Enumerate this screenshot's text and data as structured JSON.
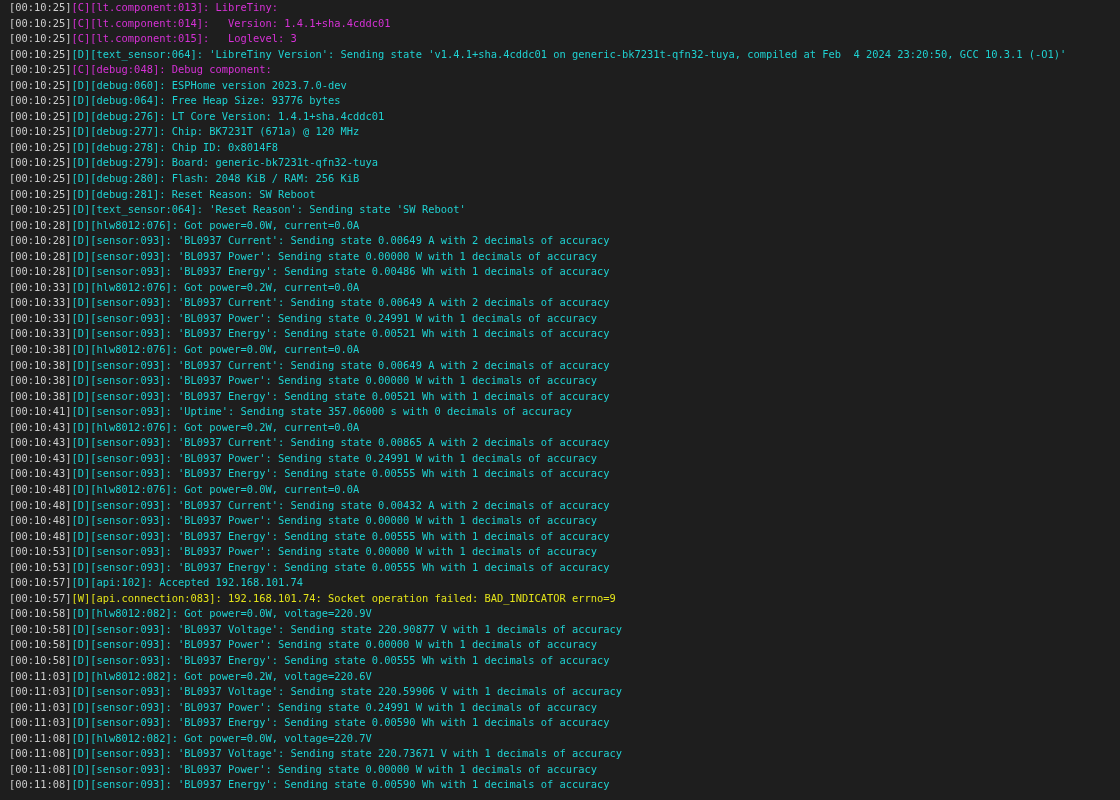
{
  "log_lines": [
    {
      "kind": "config",
      "time": "[00:10:25]",
      "text": "[C][lt.component:013]: LibreTiny:"
    },
    {
      "kind": "config",
      "time": "[00:10:25]",
      "text": "[C][lt.component:014]:   Version: 1.4.1+sha.4cddc01"
    },
    {
      "kind": "config",
      "time": "[00:10:25]",
      "text": "[C][lt.component:015]:   Loglevel: 3"
    },
    {
      "kind": "debug",
      "time": "[00:10:25]",
      "text": "[D][text_sensor:064]: 'LibreTiny Version': Sending state 'v1.4.1+sha.4cddc01 on generic-bk7231t-qfn32-tuya, compiled at Feb  4 2024 23:20:50, GCC 10.3.1 (-O1)'"
    },
    {
      "kind": "config",
      "time": "[00:10:25]",
      "text": "[C][debug:048]: Debug component:"
    },
    {
      "kind": "debug",
      "time": "[00:10:25]",
      "text": "[D][debug:060]: ESPHome version 2023.7.0-dev"
    },
    {
      "kind": "debug",
      "time": "[00:10:25]",
      "text": "[D][debug:064]: Free Heap Size: 93776 bytes"
    },
    {
      "kind": "debug",
      "time": "[00:10:25]",
      "text": "[D][debug:276]: LT Core Version: 1.4.1+sha.4cddc01"
    },
    {
      "kind": "debug",
      "time": "[00:10:25]",
      "text": "[D][debug:277]: Chip: BK7231T (671a) @ 120 MHz"
    },
    {
      "kind": "debug",
      "time": "[00:10:25]",
      "text": "[D][debug:278]: Chip ID: 0x8014F8"
    },
    {
      "kind": "debug",
      "time": "[00:10:25]",
      "text": "[D][debug:279]: Board: generic-bk7231t-qfn32-tuya"
    },
    {
      "kind": "debug",
      "time": "[00:10:25]",
      "text": "[D][debug:280]: Flash: 2048 KiB / RAM: 256 KiB"
    },
    {
      "kind": "debug",
      "time": "[00:10:25]",
      "text": "[D][debug:281]: Reset Reason: SW Reboot"
    },
    {
      "kind": "debug",
      "time": "[00:10:25]",
      "text": "[D][text_sensor:064]: 'Reset Reason': Sending state 'SW Reboot'"
    },
    {
      "kind": "debug",
      "time": "[00:10:28]",
      "text": "[D][hlw8012:076]: Got power=0.0W, current=0.0A"
    },
    {
      "kind": "debug",
      "time": "[00:10:28]",
      "text": "[D][sensor:093]: 'BL0937 Current': Sending state 0.00649 A with 2 decimals of accuracy"
    },
    {
      "kind": "debug",
      "time": "[00:10:28]",
      "text": "[D][sensor:093]: 'BL0937 Power': Sending state 0.00000 W with 1 decimals of accuracy"
    },
    {
      "kind": "debug",
      "time": "[00:10:28]",
      "text": "[D][sensor:093]: 'BL0937 Energy': Sending state 0.00486 Wh with 1 decimals of accuracy"
    },
    {
      "kind": "debug",
      "time": "[00:10:33]",
      "text": "[D][hlw8012:076]: Got power=0.2W, current=0.0A"
    },
    {
      "kind": "debug",
      "time": "[00:10:33]",
      "text": "[D][sensor:093]: 'BL0937 Current': Sending state 0.00649 A with 2 decimals of accuracy"
    },
    {
      "kind": "debug",
      "time": "[00:10:33]",
      "text": "[D][sensor:093]: 'BL0937 Power': Sending state 0.24991 W with 1 decimals of accuracy"
    },
    {
      "kind": "debug",
      "time": "[00:10:33]",
      "text": "[D][sensor:093]: 'BL0937 Energy': Sending state 0.00521 Wh with 1 decimals of accuracy"
    },
    {
      "kind": "debug",
      "time": "[00:10:38]",
      "text": "[D][hlw8012:076]: Got power=0.0W, current=0.0A"
    },
    {
      "kind": "debug",
      "time": "[00:10:38]",
      "text": "[D][sensor:093]: 'BL0937 Current': Sending state 0.00649 A with 2 decimals of accuracy"
    },
    {
      "kind": "debug",
      "time": "[00:10:38]",
      "text": "[D][sensor:093]: 'BL0937 Power': Sending state 0.00000 W with 1 decimals of accuracy"
    },
    {
      "kind": "debug",
      "time": "[00:10:38]",
      "text": "[D][sensor:093]: 'BL0937 Energy': Sending state 0.00521 Wh with 1 decimals of accuracy"
    },
    {
      "kind": "debug",
      "time": "[00:10:41]",
      "text": "[D][sensor:093]: 'Uptime': Sending state 357.06000 s with 0 decimals of accuracy"
    },
    {
      "kind": "debug",
      "time": "[00:10:43]",
      "text": "[D][hlw8012:076]: Got power=0.2W, current=0.0A"
    },
    {
      "kind": "debug",
      "time": "[00:10:43]",
      "text": "[D][sensor:093]: 'BL0937 Current': Sending state 0.00865 A with 2 decimals of accuracy"
    },
    {
      "kind": "debug",
      "time": "[00:10:43]",
      "text": "[D][sensor:093]: 'BL0937 Power': Sending state 0.24991 W with 1 decimals of accuracy"
    },
    {
      "kind": "debug",
      "time": "[00:10:43]",
      "text": "[D][sensor:093]: 'BL0937 Energy': Sending state 0.00555 Wh with 1 decimals of accuracy"
    },
    {
      "kind": "debug",
      "time": "[00:10:48]",
      "text": "[D][hlw8012:076]: Got power=0.0W, current=0.0A"
    },
    {
      "kind": "debug",
      "time": "[00:10:48]",
      "text": "[D][sensor:093]: 'BL0937 Current': Sending state 0.00432 A with 2 decimals of accuracy"
    },
    {
      "kind": "debug",
      "time": "[00:10:48]",
      "text": "[D][sensor:093]: 'BL0937 Power': Sending state 0.00000 W with 1 decimals of accuracy"
    },
    {
      "kind": "debug",
      "time": "[00:10:48]",
      "text": "[D][sensor:093]: 'BL0937 Energy': Sending state 0.00555 Wh with 1 decimals of accuracy"
    },
    {
      "kind": "debug",
      "time": "[00:10:53]",
      "text": "[D][sensor:093]: 'BL0937 Power': Sending state 0.00000 W with 1 decimals of accuracy"
    },
    {
      "kind": "debug",
      "time": "[00:10:53]",
      "text": "[D][sensor:093]: 'BL0937 Energy': Sending state 0.00555 Wh with 1 decimals of accuracy"
    },
    {
      "kind": "debug",
      "time": "[00:10:57]",
      "text": "[D][api:102]: Accepted 192.168.101.74"
    },
    {
      "kind": "warning",
      "time": "[00:10:57]",
      "text": "[W][api.connection:083]: 192.168.101.74: Socket operation failed: BAD_INDICATOR errno=9"
    },
    {
      "kind": "debug",
      "time": "[00:10:58]",
      "text": "[D][hlw8012:082]: Got power=0.0W, voltage=220.9V"
    },
    {
      "kind": "debug",
      "time": "[00:10:58]",
      "text": "[D][sensor:093]: 'BL0937 Voltage': Sending state 220.90877 V with 1 decimals of accuracy"
    },
    {
      "kind": "debug",
      "time": "[00:10:58]",
      "text": "[D][sensor:093]: 'BL0937 Power': Sending state 0.00000 W with 1 decimals of accuracy"
    },
    {
      "kind": "debug",
      "time": "[00:10:58]",
      "text": "[D][sensor:093]: 'BL0937 Energy': Sending state 0.00555 Wh with 1 decimals of accuracy"
    },
    {
      "kind": "debug",
      "time": "[00:11:03]",
      "text": "[D][hlw8012:082]: Got power=0.2W, voltage=220.6V"
    },
    {
      "kind": "debug",
      "time": "[00:11:03]",
      "text": "[D][sensor:093]: 'BL0937 Voltage': Sending state 220.59906 V with 1 decimals of accuracy"
    },
    {
      "kind": "debug",
      "time": "[00:11:03]",
      "text": "[D][sensor:093]: 'BL0937 Power': Sending state 0.24991 W with 1 decimals of accuracy"
    },
    {
      "kind": "debug",
      "time": "[00:11:03]",
      "text": "[D][sensor:093]: 'BL0937 Energy': Sending state 0.00590 Wh with 1 decimals of accuracy"
    },
    {
      "kind": "debug",
      "time": "[00:11:08]",
      "text": "[D][hlw8012:082]: Got power=0.0W, voltage=220.7V"
    },
    {
      "kind": "debug",
      "time": "[00:11:08]",
      "text": "[D][sensor:093]: 'BL0937 Voltage': Sending state 220.73671 V with 1 decimals of accuracy"
    },
    {
      "kind": "debug",
      "time": "[00:11:08]",
      "text": "[D][sensor:093]: 'BL0937 Power': Sending state 0.00000 W with 1 decimals of accuracy"
    },
    {
      "kind": "debug",
      "time": "[00:11:08]",
      "text": "[D][sensor:093]: 'BL0937 Energy': Sending state 0.00590 Wh with 1 decimals of accuracy"
    }
  ]
}
